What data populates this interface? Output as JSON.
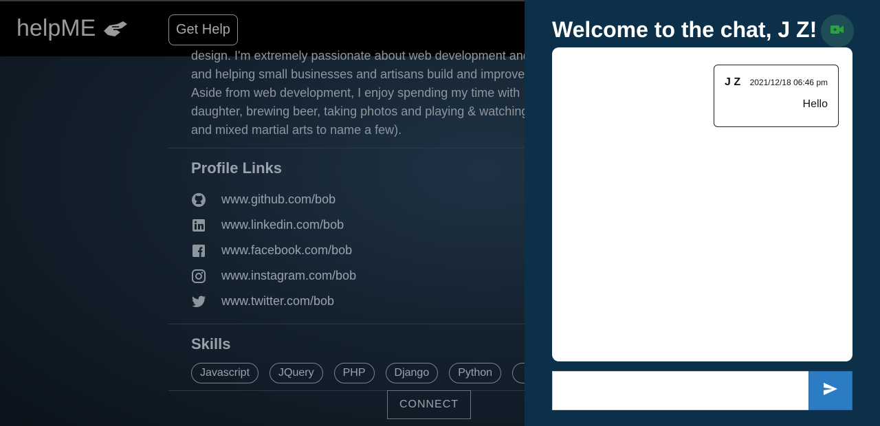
{
  "navbar": {
    "brand": "helpME",
    "get_help_label": "Get Help"
  },
  "profile": {
    "bio_lines": [
      "design. I'm extremely passionate about web development and",
      "and helping small businesses and artisans build and improve",
      "Aside from web development, I enjoy spending my time with",
      "daughter, brewing beer, taking photos and playing & watching",
      "and mixed martial arts to name a few)."
    ],
    "links_title": "Profile Links",
    "links": [
      {
        "icon": "github-icon",
        "label": "www.github.com/bob"
      },
      {
        "icon": "linkedin-icon",
        "label": "www.linkedin.com/bob"
      },
      {
        "icon": "facebook-icon",
        "label": "www.facebook.com/bob"
      },
      {
        "icon": "instagram-icon",
        "label": "www.instagram.com/bob"
      },
      {
        "icon": "twitter-icon",
        "label": "www.twitter.com/bob"
      }
    ],
    "skills_title": "Skills",
    "skills": [
      "Javascript",
      "JQuery",
      "PHP",
      "Django",
      "Python"
    ],
    "connect_label": "CONNECT"
  },
  "chat": {
    "title": "Welcome to the chat, J Z!",
    "video_icon": "video-camera-icon",
    "messages": [
      {
        "user": "J Z",
        "time": "2021/12/18 06:46 pm",
        "text": "Hello"
      }
    ],
    "input_value": "",
    "send_icon": "send-icon"
  },
  "colors": {
    "chat_bg": "#0c3049",
    "send_button": "#2c7cc4",
    "video_icon": "#2ea043"
  }
}
